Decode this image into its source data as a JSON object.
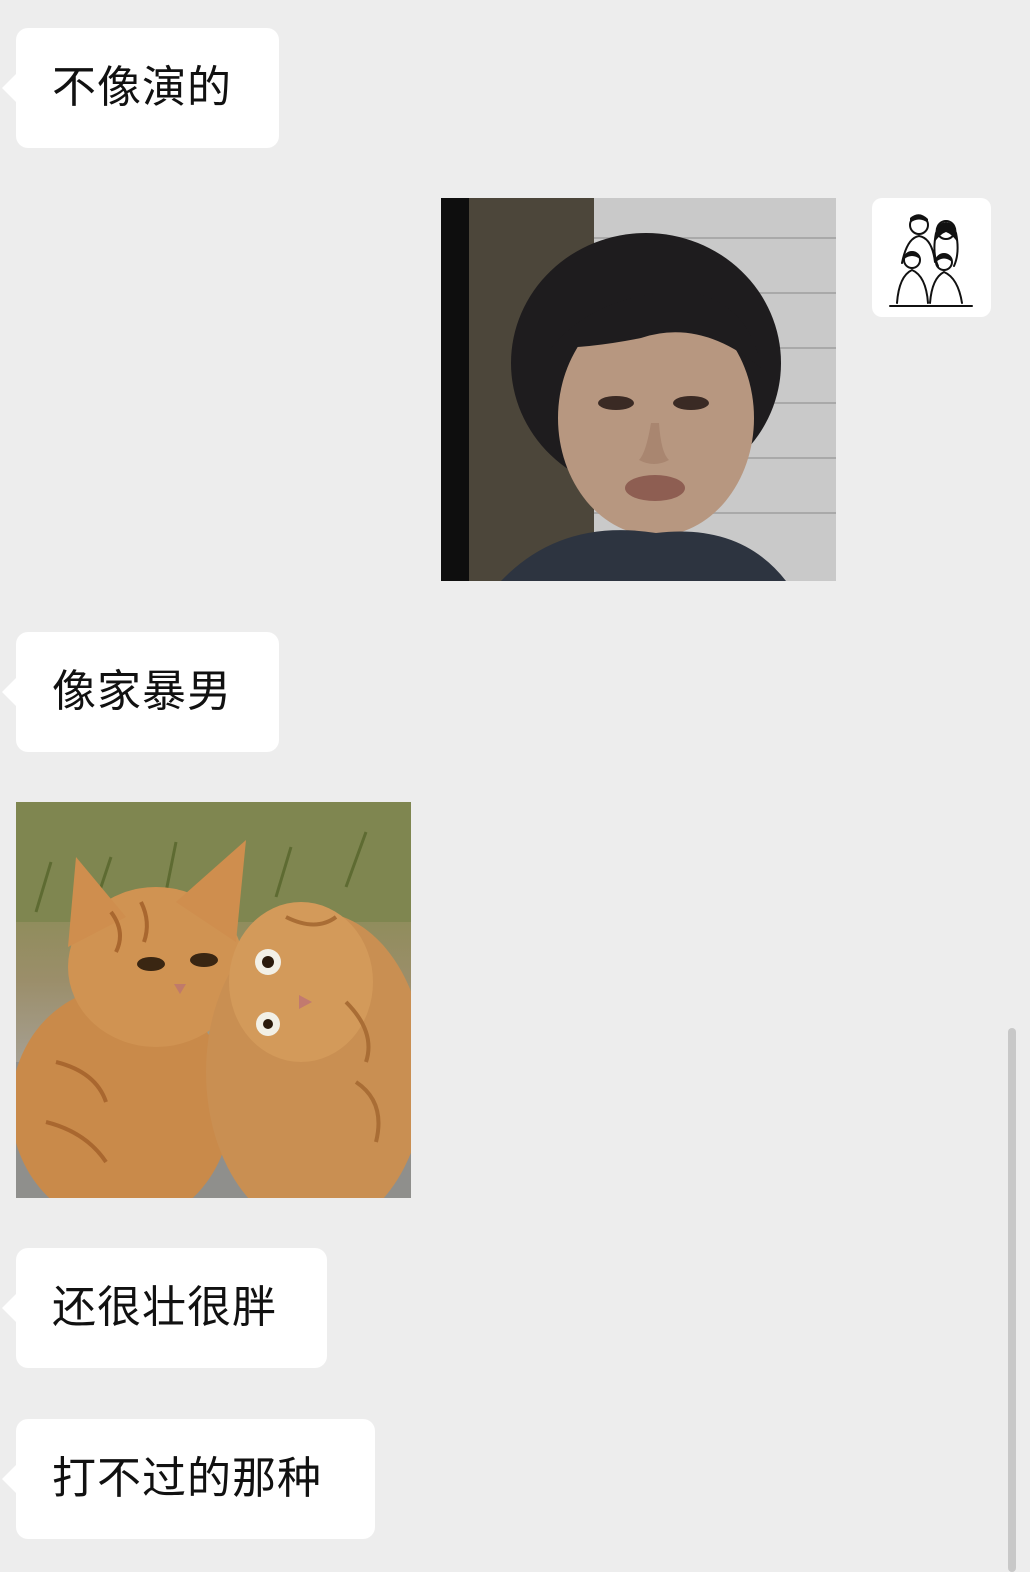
{
  "messages": [
    {
      "type": "text",
      "side": "left",
      "text": "不像演的"
    },
    {
      "type": "image",
      "side": "right",
      "icon": "person-photo-sticker"
    },
    {
      "type": "text",
      "side": "left",
      "text": "像家暴男"
    },
    {
      "type": "image",
      "side": "left",
      "icon": "cats-photo-sticker"
    },
    {
      "type": "text",
      "side": "left",
      "text": "还很壮很胖"
    },
    {
      "type": "text",
      "side": "left",
      "text": "打不过的那种"
    }
  ],
  "colors": {
    "background": "#ededed",
    "bubble": "#ffffff",
    "text": "#111111"
  }
}
